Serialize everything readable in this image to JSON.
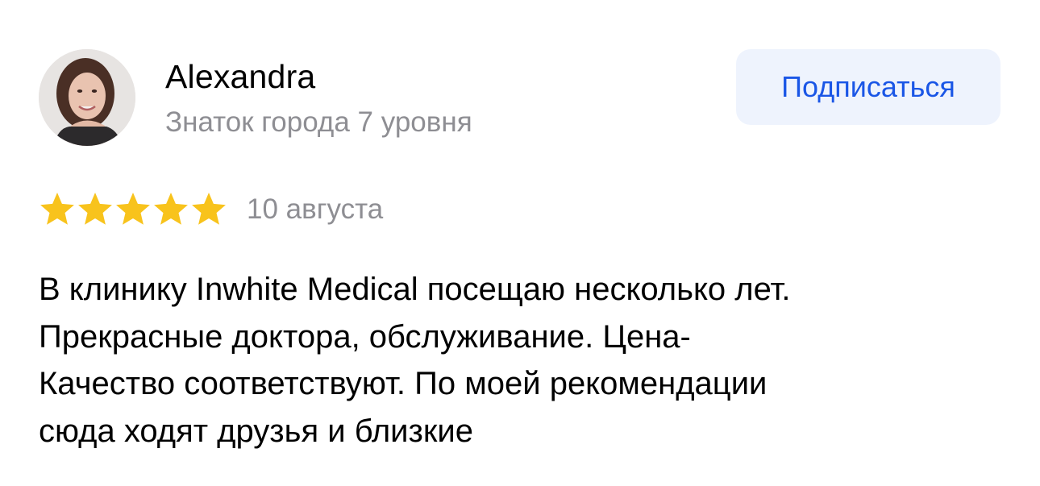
{
  "author": {
    "name": "Alexandra",
    "level": "Знаток города 7 уровня"
  },
  "actions": {
    "subscribe_label": "Подписаться"
  },
  "review": {
    "rating": 5,
    "rating_max": 5,
    "date": "10 августа",
    "text": "В клинику Inwhite Medical  посещаю несколько лет.\nПрекрасные доктора,  обслуживание. Цена-\nКачество соответствуют. По моей рекомендации\nсюда ходят друзья и близкие"
  },
  "colors": {
    "star": "#F8C31C",
    "accent": "#1A56E6",
    "secondary_text": "#8E8E93",
    "button_bg": "#EEF3FD"
  },
  "icons": {
    "avatar": "user-photo",
    "star": "star-icon"
  }
}
